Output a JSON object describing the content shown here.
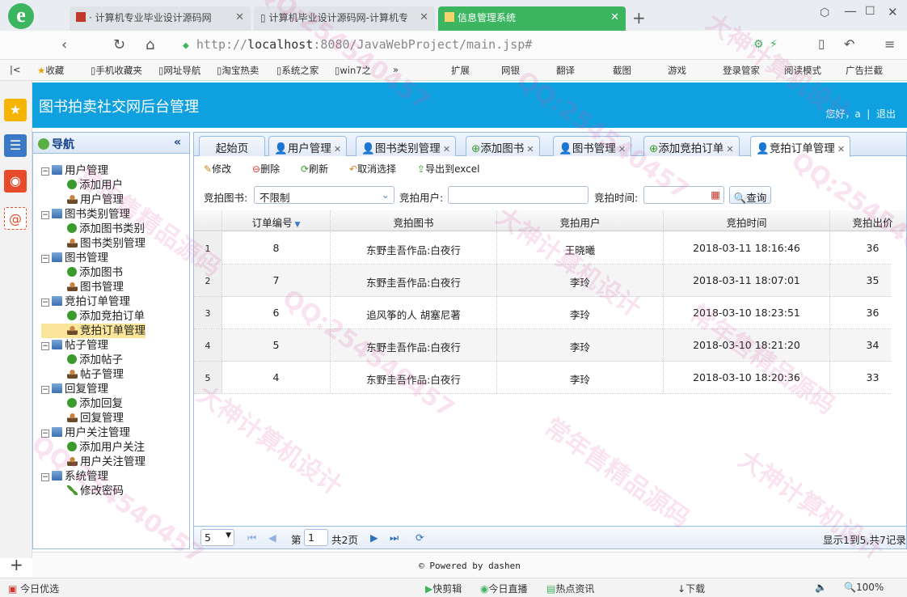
{
  "browser": {
    "tabs": [
      {
        "label": "· 计算机专业毕业设计源码网"
      },
      {
        "label": "计算机毕业设计源码网-计算机专"
      },
      {
        "label": "信息管理系统"
      }
    ],
    "url_prefix": "http://",
    "url_host": "localhost",
    "url_rest": ":8080/JavaWebProject/main.jsp#",
    "bookmarks": [
      "收藏",
      "手机收藏夹",
      "网址导航",
      "淘宝热卖",
      "系统之家",
      "win7之",
      "»",
      "扩展",
      "网银",
      "翻译",
      "截图",
      "游戏",
      "登录管家",
      "阅读模式",
      "广告拦截"
    ]
  },
  "app": {
    "title": "图书拍卖社交网后台管理",
    "greeting": "您好，a",
    "logout": "退出"
  },
  "nav": {
    "title": "导航",
    "groups": [
      {
        "label": "用户管理",
        "items": [
          "添加用户",
          "用户管理"
        ]
      },
      {
        "label": "图书类别管理",
        "items": [
          "添加图书类别",
          "图书类别管理"
        ]
      },
      {
        "label": "图书管理",
        "items": [
          "添加图书",
          "图书管理"
        ]
      },
      {
        "label": "竞拍订单管理",
        "items": [
          "添加竞拍订单",
          "竞拍订单管理"
        ]
      },
      {
        "label": "帖子管理",
        "items": [
          "添加帖子",
          "帖子管理"
        ]
      },
      {
        "label": "回复管理",
        "items": [
          "添加回复",
          "回复管理"
        ]
      },
      {
        "label": "用户关注管理",
        "items": [
          "添加用户关注",
          "用户关注管理"
        ]
      },
      {
        "label": "系统管理",
        "items": [
          "修改密码"
        ]
      }
    ]
  },
  "tabs": [
    "起始页",
    "用户管理",
    "图书类别管理",
    "添加图书",
    "图书管理",
    "添加竞拍订单",
    "竞拍订单管理"
  ],
  "toolbar": {
    "edit": "修改",
    "delete": "删除",
    "refresh": "刷新",
    "cancel_select": "取消选择",
    "export": "导出到excel"
  },
  "filters": {
    "book_label": "竞拍图书:",
    "book_value": "不限制",
    "user_label": "竞拍用户:",
    "user_value": "",
    "time_label": "竞拍时间:",
    "time_value": "",
    "query": "查询"
  },
  "grid": {
    "columns": [
      "订单编号",
      "竞拍图书",
      "竞拍用户",
      "竞拍时间",
      "竞拍出价"
    ],
    "rows": [
      {
        "n": "1",
        "id": "8",
        "book": "东野圭吾作品:白夜行",
        "user": "王晓曦",
        "time": "2018-03-11 18:16:46",
        "price": "36"
      },
      {
        "n": "2",
        "id": "7",
        "book": "东野圭吾作品:白夜行",
        "user": "李玲",
        "time": "2018-03-11 18:07:01",
        "price": "35"
      },
      {
        "n": "3",
        "id": "6",
        "book": "追风筝的人 胡塞尼著",
        "user": "李玲",
        "time": "2018-03-10 18:23:51",
        "price": "36"
      },
      {
        "n": "4",
        "id": "5",
        "book": "东野圭吾作品:白夜行",
        "user": "李玲",
        "time": "2018-03-10 18:21:20",
        "price": "34"
      },
      {
        "n": "5",
        "id": "4",
        "book": "东野圭吾作品:白夜行",
        "user": "李玲",
        "time": "2018-03-10 18:20:36",
        "price": "33"
      }
    ]
  },
  "pager": {
    "page_size": "5",
    "page_prefix": "第",
    "page_value": "1",
    "page_total": "共2页",
    "summary": "显示1到5,共7记录"
  },
  "footer": "© Powered by dashen",
  "statusbar": {
    "left": "今日优选",
    "items": [
      "快剪辑",
      "今日直播",
      "热点资讯",
      "下载",
      "100%"
    ]
  },
  "colors": {
    "header": "#0fa0e0",
    "border": "#99bbe8",
    "selected": "#fbe59a",
    "active_browser_tab": "#3bb55f"
  },
  "watermarks": [
    "QQ:254540457",
    "大神计算机设计",
    "常年售精品源码"
  ]
}
